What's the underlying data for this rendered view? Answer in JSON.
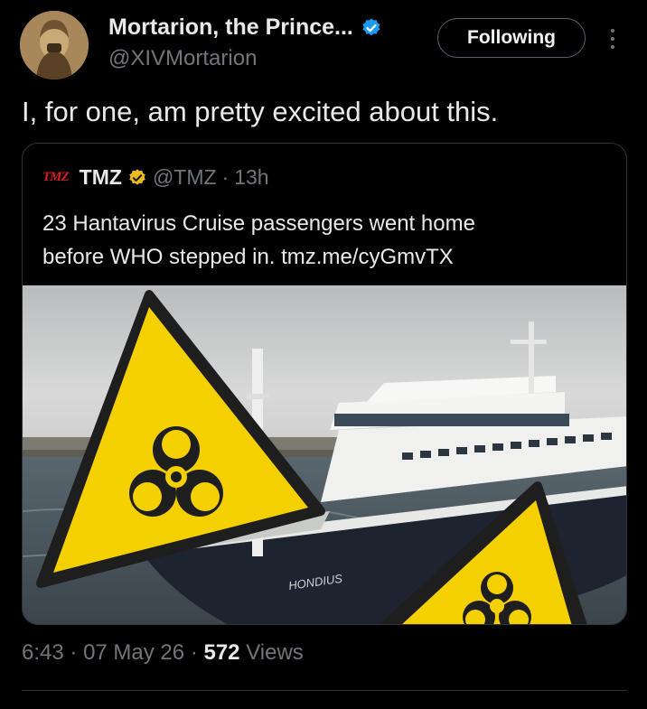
{
  "author": {
    "display_name": "Mortarion, the Prince...",
    "handle": "@XIVMortarion",
    "verified_color": "#1d9bf0",
    "avatar_icon": "avatar-portrait"
  },
  "follow_button": {
    "label": "Following"
  },
  "more_icon": "more-vertical-icon",
  "tweet": {
    "text": "I, for one, am pretty excited about this."
  },
  "quote": {
    "logo_text": "TMZ",
    "name": "TMZ",
    "badge_color": "#e8b923",
    "handle": "@TMZ",
    "separator": "·",
    "time": "13h",
    "text_line1": "23 Hantavirus Cruise passengers went home",
    "text_line2": "before WHO stepped in. tmz.me/cyGmvTX",
    "image": {
      "ship_name": "HONDIUS",
      "hazard_color": "#f5d000"
    }
  },
  "meta": {
    "time": "6:43",
    "date": "07 May 26",
    "separator": "·",
    "views_count": "572",
    "views_label": "Views"
  },
  "colors": {
    "background": "#000000",
    "text_primary": "#e7e9ea",
    "text_secondary": "#71767b",
    "border": "#2f3336"
  }
}
